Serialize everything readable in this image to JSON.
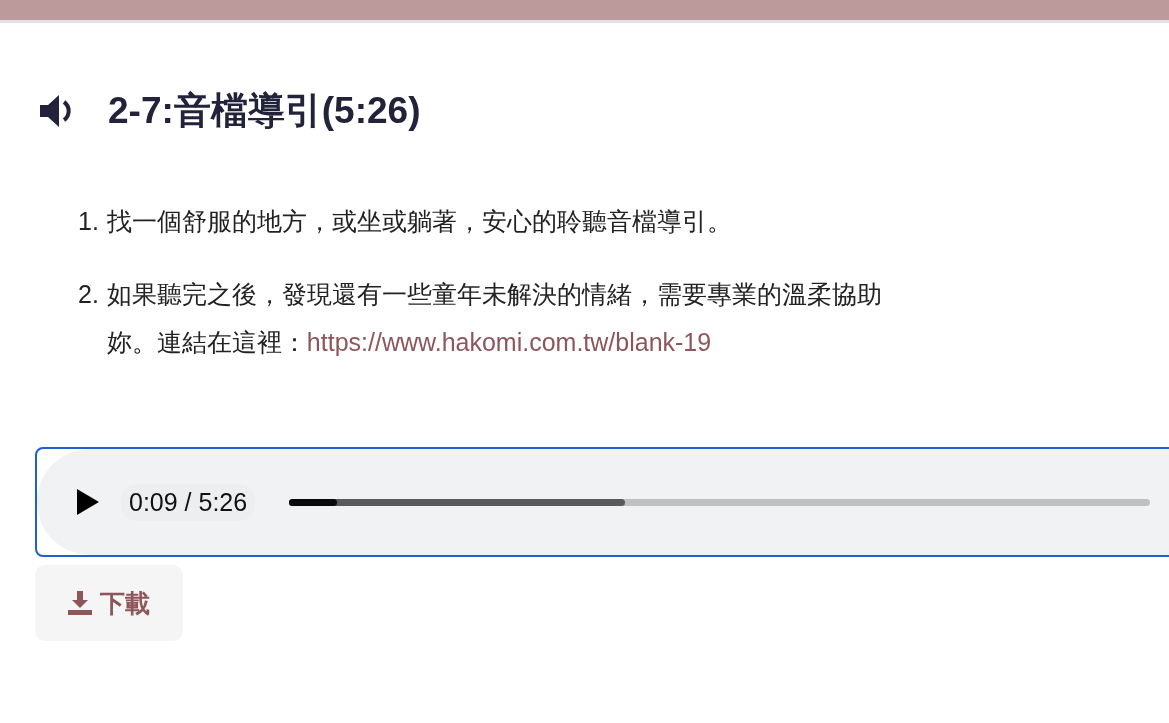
{
  "heading": {
    "title": "2-7:音檔導引(5:26)"
  },
  "steps": [
    {
      "number": "1.",
      "lines": [
        "找一個舒服的地方，或坐或躺著，安心的聆聽音檔導引。"
      ]
    },
    {
      "number": "2.",
      "lines": [
        "如果聽完之後，發現還有一些童年未解決的情緒，需要專業的溫柔協助",
        "妳。連結在這裡："
      ],
      "link": "https://www.hakomi.com.tw/blank-19"
    }
  ],
  "player": {
    "focused": true,
    "time": "0:09 / 5:26",
    "progress": {
      "level": 0.055
    },
    "buffered": {
      "level": 0.39
    }
  },
  "download_button": {
    "label": "下載"
  }
}
